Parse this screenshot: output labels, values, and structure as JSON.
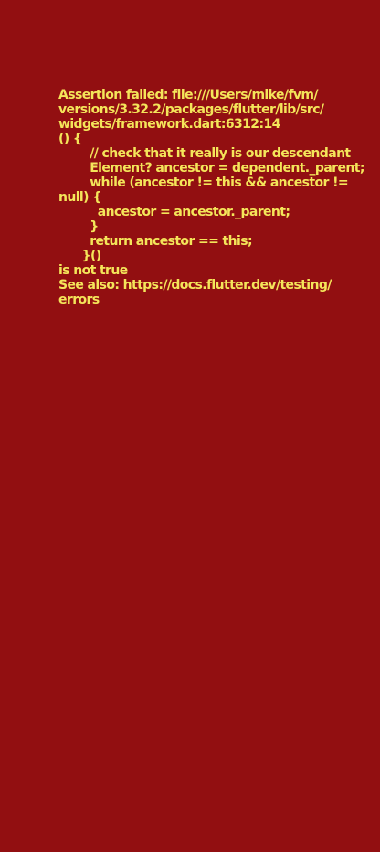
{
  "colors": {
    "background": "#920f11",
    "text": "#f4e55a"
  },
  "error": {
    "message": "Assertion failed: file:///Users/mike/fvm/\nversions/3.32.2/packages/flutter/lib/src/\nwidgets/framework.dart:6312:14\n() {\n        // check that it really is our descendant\n        Element? ancestor = dependent._parent;\n        while (ancestor != this && ancestor !=\nnull) {\n          ancestor = ancestor._parent;\n        }\n        return ancestor == this;\n      }()\nis not true\nSee also: https://docs.flutter.dev/testing/\nerrors"
  }
}
